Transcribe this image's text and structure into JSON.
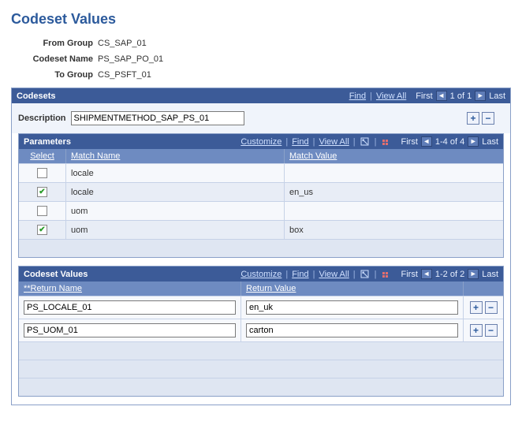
{
  "page": {
    "title": "Codeset Values"
  },
  "header": {
    "from_group": {
      "label": "From Group",
      "value": "CS_SAP_01"
    },
    "codeset_name": {
      "label": "Codeset Name",
      "value": "PS_SAP_PO_01"
    },
    "to_group": {
      "label": "To Group",
      "value": "CS_PSFT_01"
    }
  },
  "codesets": {
    "bar_title": "Codesets",
    "find": "Find",
    "view_all": "View All",
    "first": "First",
    "counter": "1 of 1",
    "last": "Last",
    "description_label": "Description",
    "description_value": "SHIPMENTMETHOD_SAP_PS_01"
  },
  "parameters": {
    "bar_title": "Parameters",
    "customize": "Customize",
    "find": "Find",
    "view_all": "View All",
    "first": "First",
    "counter": "1-4 of 4",
    "last": "Last",
    "col_select": "Select",
    "col_match_name": "Match Name",
    "col_match_value": "Match Value",
    "rows": [
      {
        "selected": false,
        "name": "locale",
        "value": ""
      },
      {
        "selected": true,
        "name": "locale",
        "value": "en_us"
      },
      {
        "selected": false,
        "name": "uom",
        "value": ""
      },
      {
        "selected": true,
        "name": "uom",
        "value": "box"
      }
    ]
  },
  "codeset_values": {
    "bar_title": "Codeset Values",
    "customize": "Customize",
    "find": "Find",
    "view_all": "View All",
    "first": "First",
    "counter": "1-2 of 2",
    "last": "Last",
    "col_return_name": "*Return Name",
    "col_return_value": "Return Value",
    "rows": [
      {
        "name": "PS_LOCALE_01",
        "value": "en_uk"
      },
      {
        "name": "PS_UOM_01",
        "value": "carton"
      }
    ]
  }
}
